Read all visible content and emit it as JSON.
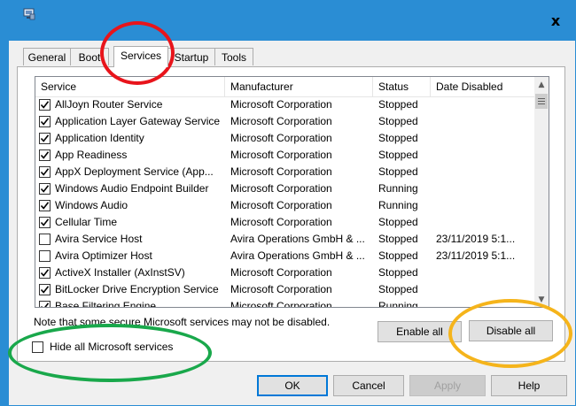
{
  "window": {
    "close_symbol": "x"
  },
  "tabs": [
    "General",
    "Boot",
    "Services",
    "Startup",
    "Tools"
  ],
  "columns": [
    "Service",
    "Manufacturer",
    "Status",
    "Date Disabled"
  ],
  "services": [
    {
      "name": "AllJoyn Router Service",
      "manufacturer": "Microsoft Corporation",
      "status": "Stopped",
      "date": "",
      "checked": true
    },
    {
      "name": "Application Layer Gateway Service",
      "manufacturer": "Microsoft Corporation",
      "status": "Stopped",
      "date": "",
      "checked": true
    },
    {
      "name": "Application Identity",
      "manufacturer": "Microsoft Corporation",
      "status": "Stopped",
      "date": "",
      "checked": true
    },
    {
      "name": "App Readiness",
      "manufacturer": "Microsoft Corporation",
      "status": "Stopped",
      "date": "",
      "checked": true
    },
    {
      "name": "AppX Deployment Service (App...",
      "manufacturer": "Microsoft Corporation",
      "status": "Stopped",
      "date": "",
      "checked": true
    },
    {
      "name": "Windows Audio Endpoint Builder",
      "manufacturer": "Microsoft Corporation",
      "status": "Running",
      "date": "",
      "checked": true
    },
    {
      "name": "Windows Audio",
      "manufacturer": "Microsoft Corporation",
      "status": "Running",
      "date": "",
      "checked": true
    },
    {
      "name": "Cellular Time",
      "manufacturer": "Microsoft Corporation",
      "status": "Stopped",
      "date": "",
      "checked": true
    },
    {
      "name": "Avira Service Host",
      "manufacturer": "Avira Operations GmbH & ...",
      "status": "Stopped",
      "date": "23/11/2019 5:1...",
      "checked": false
    },
    {
      "name": "Avira Optimizer Host",
      "manufacturer": "Avira Operations GmbH & ...",
      "status": "Stopped",
      "date": "23/11/2019 5:1...",
      "checked": false
    },
    {
      "name": "ActiveX Installer (AxInstSV)",
      "manufacturer": "Microsoft Corporation",
      "status": "Stopped",
      "date": "",
      "checked": true
    },
    {
      "name": "BitLocker Drive Encryption Service",
      "manufacturer": "Microsoft Corporation",
      "status": "Stopped",
      "date": "",
      "checked": true
    },
    {
      "name": "Base Filtering Engine",
      "manufacturer": "Microsoft Corporation",
      "status": "Running",
      "date": "",
      "checked": true
    }
  ],
  "note": "Note that some secure Microsoft services may not be disabled.",
  "hide_ms_label": "Hide all Microsoft services",
  "hide_ms_checked": false,
  "buttons": {
    "enable_all": "Enable all",
    "disable_all": "Disable all",
    "ok": "OK",
    "cancel": "Cancel",
    "apply": "Apply",
    "help": "Help"
  },
  "colors": {
    "titlebar": "#2a8dd4",
    "annotation_red": "#e8141b",
    "annotation_green": "#19a84b",
    "annotation_yellow": "#f5b41b"
  }
}
